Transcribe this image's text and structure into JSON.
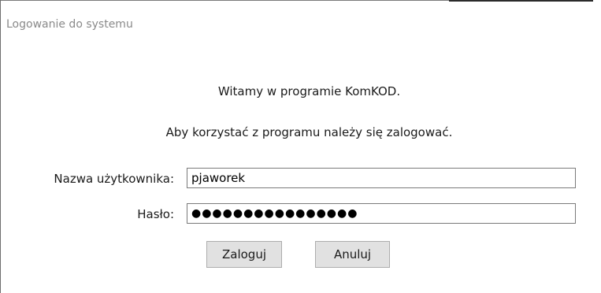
{
  "window": {
    "title": "Logowanie do systemu"
  },
  "content": {
    "welcome_text": "Witamy w programie KomKOD.",
    "instruction_text": "Aby korzystać z programu należy się zalogować."
  },
  "form": {
    "username_label": "Nazwa użytkownika:",
    "username_value": "pjaworek",
    "password_label": "Hasło:",
    "password_value": "●●●●●●●●●●●●●●●●"
  },
  "buttons": {
    "login_label": "Zaloguj",
    "cancel_label": "Anuluj"
  }
}
